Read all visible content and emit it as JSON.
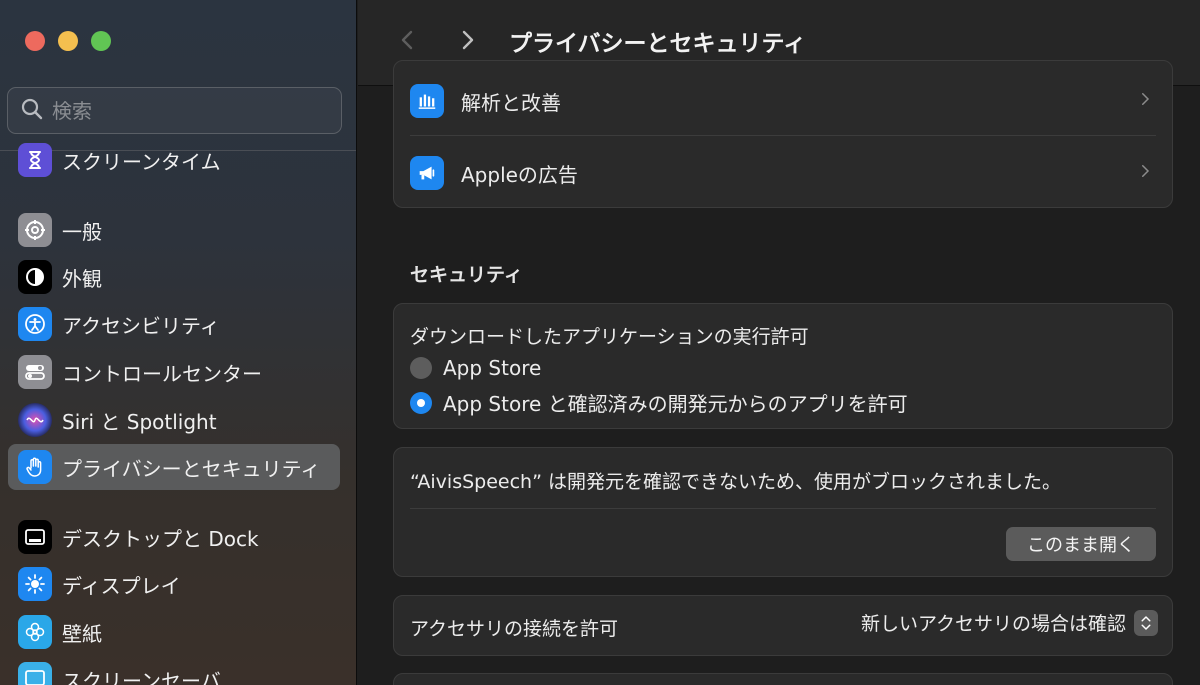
{
  "window": {
    "title": "プライバシーとセキュリティ"
  },
  "sidebar": {
    "search_placeholder": "検索",
    "items": [
      {
        "label": "スクリーンタイム",
        "icon": "hourglass-icon",
        "color": "#5e4fd6"
      },
      {
        "label": "一般",
        "icon": "gear-icon",
        "color": "#8e8e93"
      },
      {
        "label": "外観",
        "icon": "appearance-icon",
        "color": "#000000"
      },
      {
        "label": "アクセシビリティ",
        "icon": "accessibility-icon",
        "color": "#1e87f0"
      },
      {
        "label": "コントロールセンター",
        "icon": "control-center-icon",
        "color": "#8e8e93"
      },
      {
        "label": "Siri と Spotlight",
        "icon": "siri-icon",
        "color": "#2c2c5c"
      },
      {
        "label": "プライバシーとセキュリティ",
        "icon": "hand-icon",
        "color": "#1e87f0"
      },
      {
        "label": "デスクトップと Dock",
        "icon": "dock-icon",
        "color": "#000000"
      },
      {
        "label": "ディスプレイ",
        "icon": "sun-icon",
        "color": "#1e87f0"
      },
      {
        "label": "壁紙",
        "icon": "flower-icon",
        "color": "#2aa7e8"
      },
      {
        "label": "スクリーンセーバ",
        "icon": "screensaver-icon",
        "color": "#3ab0e8"
      }
    ]
  },
  "privacy": {
    "analytics_label": "解析と改善",
    "ads_label": "Appleの広告"
  },
  "security": {
    "heading": "セキュリティ",
    "downloads_title": "ダウンロードしたアプリケーションの実行許可",
    "option_app_store": "App Store",
    "option_app_store_dev": "App Store と確認済みの開発元からのアプリを許可",
    "blocked_message": "“AivisSpeech” は開発元を確認できないため、使用がブロックされました。",
    "open_anyway": "このまま開く",
    "accessories_label": "アクセサリの接続を許可",
    "accessories_value": "新しいアクセサリの場合は確認"
  },
  "colors": {
    "accent": "#1e87f0",
    "close": "#ed6a5e",
    "minimize": "#f4bf4f",
    "maximize": "#61c554"
  }
}
